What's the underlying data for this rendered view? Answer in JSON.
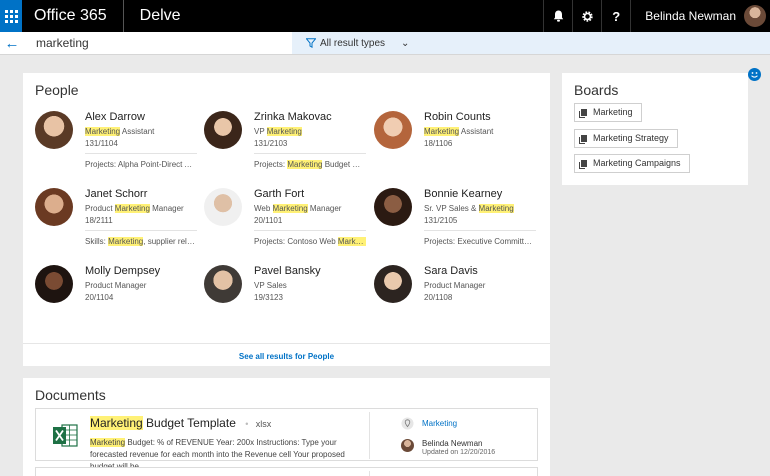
{
  "header": {
    "suite_title": "Office 365",
    "app_title": "Delve",
    "user_name": "Belinda Newman",
    "icons": [
      "bell-icon",
      "gear-icon",
      "help-icon"
    ]
  },
  "search": {
    "query": "marketing",
    "filter_label": "All result types"
  },
  "people": {
    "title": "People",
    "see_all": "See all results for People",
    "items": [
      {
        "name": "Alex Darrow",
        "title_pre": "",
        "title_hl": "Marketing",
        "title_post": " Assistant",
        "id": "131/1104",
        "extra_pre": "Projects: Alpha Point-Direct Ap...",
        "extra_hl": "",
        "extra_post": ""
      },
      {
        "name": "Zrinka Makovac",
        "title_pre": "VP ",
        "title_hl": "Marketing",
        "title_post": "",
        "id": "131/2103",
        "extra_pre": "Projects: ",
        "extra_hl": "Marketing",
        "extra_post": " Budget Rev..."
      },
      {
        "name": "Robin Counts",
        "title_pre": "",
        "title_hl": "Marketing",
        "title_post": " Assistant",
        "id": "18/1106",
        "extra_pre": "",
        "extra_hl": "",
        "extra_post": ""
      },
      {
        "name": "Janet Schorr",
        "title_pre": "Product ",
        "title_hl": "Marketing",
        "title_post": " Manager",
        "id": "18/2111",
        "extra_pre": "Skills: ",
        "extra_hl": "Marketing",
        "extra_post": ", supplier relationship..."
      },
      {
        "name": "Garth Fort",
        "title_pre": "Web ",
        "title_hl": "Marketing",
        "title_post": " Manager",
        "id": "20/1101",
        "extra_pre": "Projects: Contoso Web ",
        "extra_hl": "Marketi...",
        "extra_post": ""
      },
      {
        "name": "Bonnie Kearney",
        "title_pre": "Sr. VP Sales & ",
        "title_hl": "Marketing",
        "title_post": "",
        "id": "131/2105",
        "extra_pre": "Projects: Executive Committee...",
        "extra_hl": "",
        "extra_post": ""
      },
      {
        "name": "Molly Dempsey",
        "title_pre": "Product Manager",
        "title_hl": "",
        "title_post": "",
        "id": "20/1104",
        "extra_pre": "",
        "extra_hl": "",
        "extra_post": ""
      },
      {
        "name": "Pavel Bansky",
        "title_pre": "VP Sales",
        "title_hl": "",
        "title_post": "",
        "id": "19/3123",
        "extra_pre": "",
        "extra_hl": "",
        "extra_post": ""
      },
      {
        "name": "Sara Davis",
        "title_pre": "Product Manager",
        "title_hl": "",
        "title_post": "",
        "id": "20/1108",
        "extra_pre": "",
        "extra_hl": "",
        "extra_post": ""
      }
    ]
  },
  "boards": {
    "title": "Boards",
    "items": [
      "Marketing",
      "Marketing Strategy",
      "Marketing Campaigns"
    ]
  },
  "documents": {
    "title": "Documents",
    "items": [
      {
        "title_hl": "Marketing",
        "title_post": " Budget Template",
        "ext": "xlsx",
        "snippet_hl": "Marketing",
        "snippet_post": " Budget: % of REVENUE Year: 200x Instructions: Type your forecasted revenue for each month into the Revenue cell Your proposed budget will be",
        "board": "Marketing",
        "author": "Belinda Newman",
        "updated": "Updated on 12/20/2016"
      }
    ]
  },
  "colors": {
    "accent": "#0072c6",
    "highlight": "#fff176",
    "excel": "#1e7145"
  }
}
